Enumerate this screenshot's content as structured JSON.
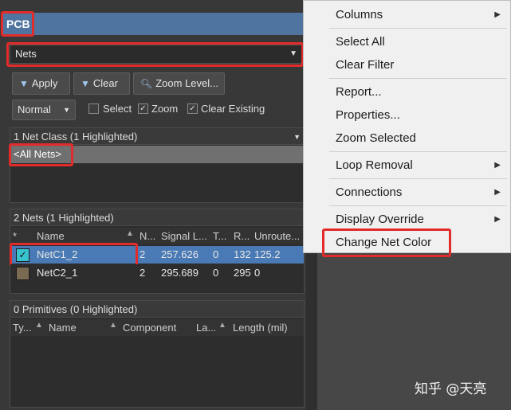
{
  "panel": {
    "title": "PCB",
    "filter_select": "Nets",
    "buttons": {
      "apply": "Apply",
      "clear": "Clear",
      "zoom_level": "Zoom Level..."
    },
    "mode_select": "Normal",
    "checkboxes": {
      "select": {
        "label": "Select",
        "checked": false
      },
      "zoom": {
        "label": "Zoom",
        "checked": true
      },
      "clear_existing": {
        "label": "Clear Existing",
        "checked": true
      }
    },
    "net_class_header": "1 Net Class (1 Highlighted)",
    "net_class_item": "<All Nets>",
    "nets_header": "2 Nets (1 Highlighted)",
    "nets_columns": [
      "*",
      "Name",
      "N...",
      "Signal L...",
      "T...",
      "R...",
      "Unroute..."
    ],
    "nets_rows": [
      {
        "color": "#39c3cf",
        "checked": true,
        "name": "NetC1_2",
        "n": "2",
        "signal_length": "257.626",
        "t": "0",
        "r": "132",
        "unrouted": "125.2"
      },
      {
        "color": "#7a6a52",
        "checked": false,
        "name": "NetC2_1",
        "n": "2",
        "signal_length": "295.689",
        "t": "0",
        "r": "295",
        "unrouted": "0"
      }
    ],
    "primitives_header": "0 Primitives (0 Highlighted)",
    "primitives_columns": [
      "Ty...",
      "Name",
      "Component",
      "La...",
      "Length (mil)"
    ]
  },
  "context_menu": {
    "items": [
      {
        "label": "Columns",
        "submenu": true
      },
      {
        "label": "Select All",
        "submenu": false
      },
      {
        "label": "Clear Filter",
        "submenu": false
      },
      {
        "label": "Report...",
        "submenu": false
      },
      {
        "label": "Properties...",
        "submenu": false
      },
      {
        "label": "Zoom Selected",
        "submenu": false
      },
      {
        "label": "Loop Removal",
        "submenu": true
      },
      {
        "label": "Connections",
        "submenu": true
      },
      {
        "label": "Display Override",
        "submenu": true
      },
      {
        "label": "Change Net Color",
        "submenu": false
      }
    ]
  },
  "watermark": "知乎 @天亮",
  "colors": {
    "highlight_red": "#e22b2b",
    "selected_row": "#4a7ab5",
    "title_bar": "#4f74a0"
  }
}
